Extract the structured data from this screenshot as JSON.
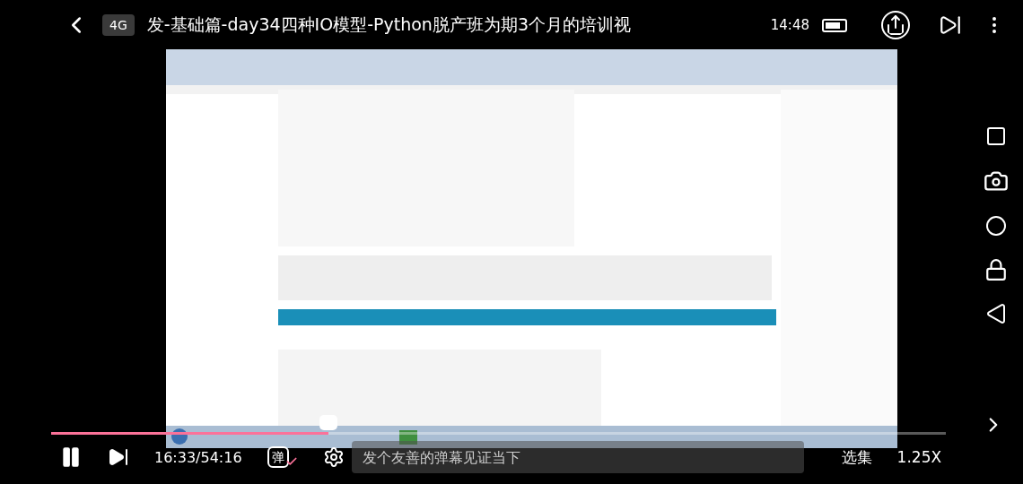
{
  "top_bar": {
    "network": "4G",
    "title": "发-基础篇-day34四种IO模型-Python脱产班为期3个月的培训视",
    "clock": "14:48"
  },
  "progress": {
    "level": 0.31
  },
  "controls": {
    "time": "16:33/54:16",
    "danmaku_label": "弹",
    "danmaku_on": true,
    "danmaku_placeholder": "发个友善的弹幕见证当下",
    "episodes": "选集",
    "speed": "1.25X"
  }
}
